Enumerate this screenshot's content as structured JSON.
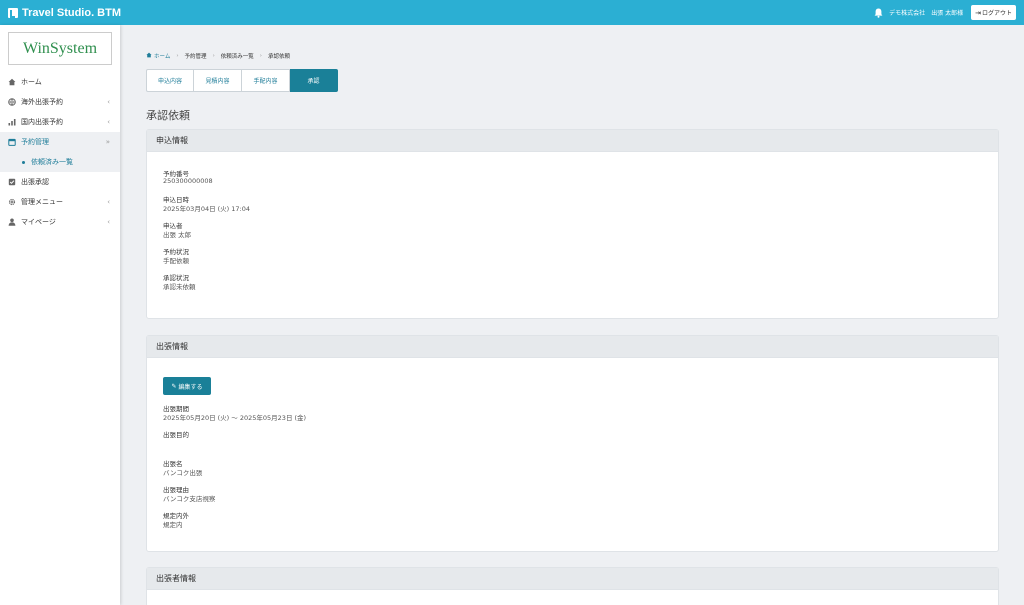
{
  "app": {
    "brand": "Travel Studio. BTM",
    "company": "デモ株式会社",
    "user": "出張 太郎様",
    "logout_label": "ログアウト"
  },
  "sidebar": {
    "logo_text": "WinSystem",
    "items": [
      {
        "label": "ホーム",
        "icon": "home-icon"
      },
      {
        "label": "海外出張予約",
        "icon": "globe-icon"
      },
      {
        "label": "国内出張予約",
        "icon": "bar-chart-icon"
      },
      {
        "label": "予約管理",
        "icon": "calendar-icon"
      },
      {
        "label": "依頼済み一覧",
        "icon": "bullet-icon"
      },
      {
        "label": "出張承認",
        "icon": "check-square-icon"
      },
      {
        "label": "管理メニュー",
        "icon": "gear-icon"
      },
      {
        "label": "マイページ",
        "icon": "user-icon"
      }
    ]
  },
  "breadcrumb": [
    "ホーム",
    "予約管理",
    "依頼済み一覧",
    "承認依頼"
  ],
  "tabs": [
    "申込内容",
    "見積内容",
    "手配内容",
    "承認"
  ],
  "page_title": "承認依頼",
  "application": {
    "header": "申込情報",
    "fields": [
      {
        "label": "予約番号",
        "value": "250300000008"
      },
      {
        "label": "申込日時",
        "value": "2025年03月04日 (火) 17:04"
      },
      {
        "label": "申込者",
        "value": "出張 太郎"
      },
      {
        "label": "予約状況",
        "value": "手配依頼"
      },
      {
        "label": "承認状況",
        "value": "承認未依頼"
      }
    ]
  },
  "trip": {
    "header": "出張情報",
    "edit_label": "編集する",
    "fields": [
      {
        "label": "出張期間",
        "value": "2025年05月20日 (火) 〜 2025年05月23日 (金)"
      },
      {
        "label": "出張目的",
        "value": ""
      },
      {
        "label": "出張名",
        "value": "バンコク出張"
      },
      {
        "label": "出張理由",
        "value": "バンコク支店視察"
      },
      {
        "label": "規定内外",
        "value": "規定内"
      }
    ]
  },
  "traveler": {
    "header": "出張者情報"
  },
  "colors": {
    "topbar": "#2bafd3",
    "accent": "#1a8098",
    "logo_green": "#2f8f4e"
  }
}
